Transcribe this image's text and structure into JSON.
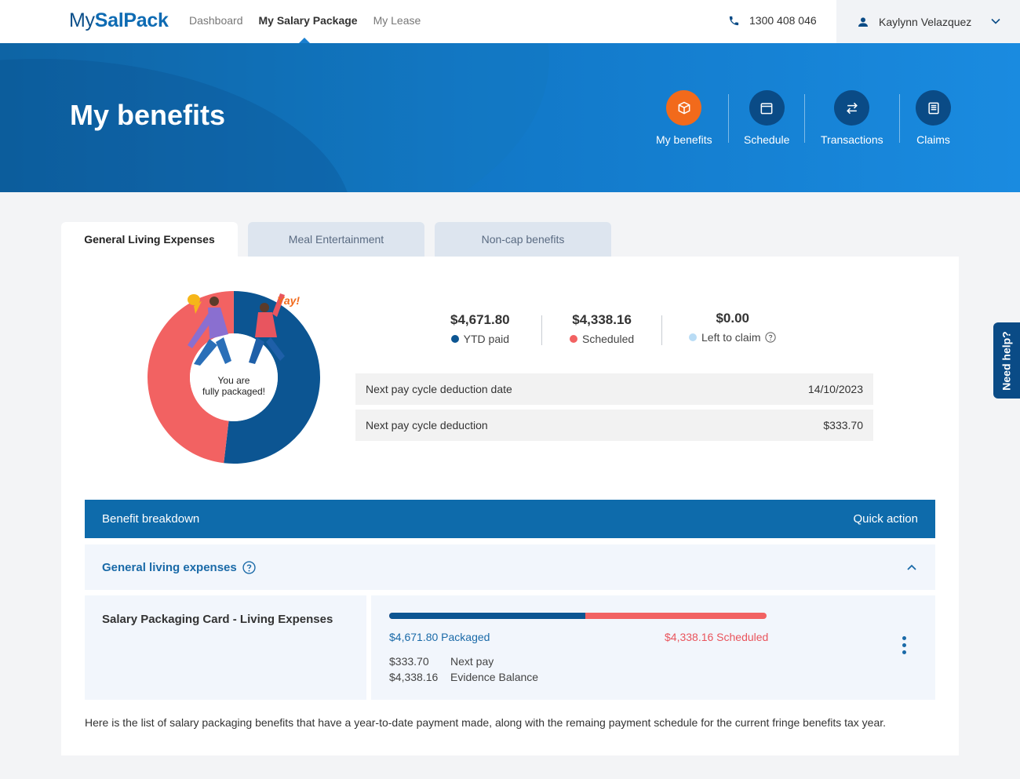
{
  "header": {
    "logo_my": "My",
    "logo_salpack": "SalPack",
    "nav": [
      {
        "label": "Dashboard",
        "active": false
      },
      {
        "label": "My Salary Package",
        "active": true
      },
      {
        "label": "My Lease",
        "active": false
      }
    ],
    "phone": "1300 408 046",
    "user_name": "Kaylynn Velazquez"
  },
  "hero": {
    "title": "My benefits",
    "actions": [
      {
        "label": "My benefits",
        "icon": "box-icon",
        "active": true
      },
      {
        "label": "Schedule",
        "icon": "calendar-icon",
        "active": false
      },
      {
        "label": "Transactions",
        "icon": "swap-arrows-icon",
        "active": false
      },
      {
        "label": "Claims",
        "icon": "receipt-icon",
        "active": false
      }
    ]
  },
  "tabs": [
    {
      "label": "General Living Expenses",
      "active": true
    },
    {
      "label": "Meal Entertainment",
      "active": false
    },
    {
      "label": "Non-cap benefits",
      "active": false
    }
  ],
  "donut": {
    "paid_fraction": 0.5185,
    "scheduled_fraction": 0.4815,
    "message_line1": "You are",
    "message_line2": "fully packaged!",
    "yay": "Yay!"
  },
  "stats": [
    {
      "value": "$4,671.80",
      "label": "YTD paid",
      "color": "#0c5592"
    },
    {
      "value": "$4,338.16",
      "label": "Scheduled",
      "color": "#f26262"
    },
    {
      "value": "$0.00",
      "label": "Left to claim",
      "color": "#b9dcf5"
    }
  ],
  "info": [
    {
      "label": "Next pay cycle deduction date",
      "value": "14/10/2023"
    },
    {
      "label": "Next pay cycle deduction",
      "value": "$333.70"
    }
  ],
  "breakdown": {
    "title": "Benefit breakdown",
    "quick_action": "Quick action",
    "section_title": "General living expenses",
    "item": {
      "name": "Salary Packaging Card - Living Expenses",
      "packaged_fraction": 0.52,
      "packaged_label": "$4,671.80 Packaged",
      "scheduled_label": "$4,338.16 Scheduled",
      "next_pay_amount": "$333.70",
      "next_pay_label": "Next pay",
      "evidence_amount": "$4,338.16",
      "evidence_label": "Evidence Balance"
    }
  },
  "footnote": "Here is the list of salary packaging benefits that have a year-to-date payment made, along with the remaing payment schedule for the current fringe benefits tax year.",
  "help": "Need help?",
  "colors": {
    "primary": "#0e6bab",
    "accent_orange": "#f26a1b",
    "paid_blue": "#0c5592",
    "scheduled_red": "#f26262"
  }
}
